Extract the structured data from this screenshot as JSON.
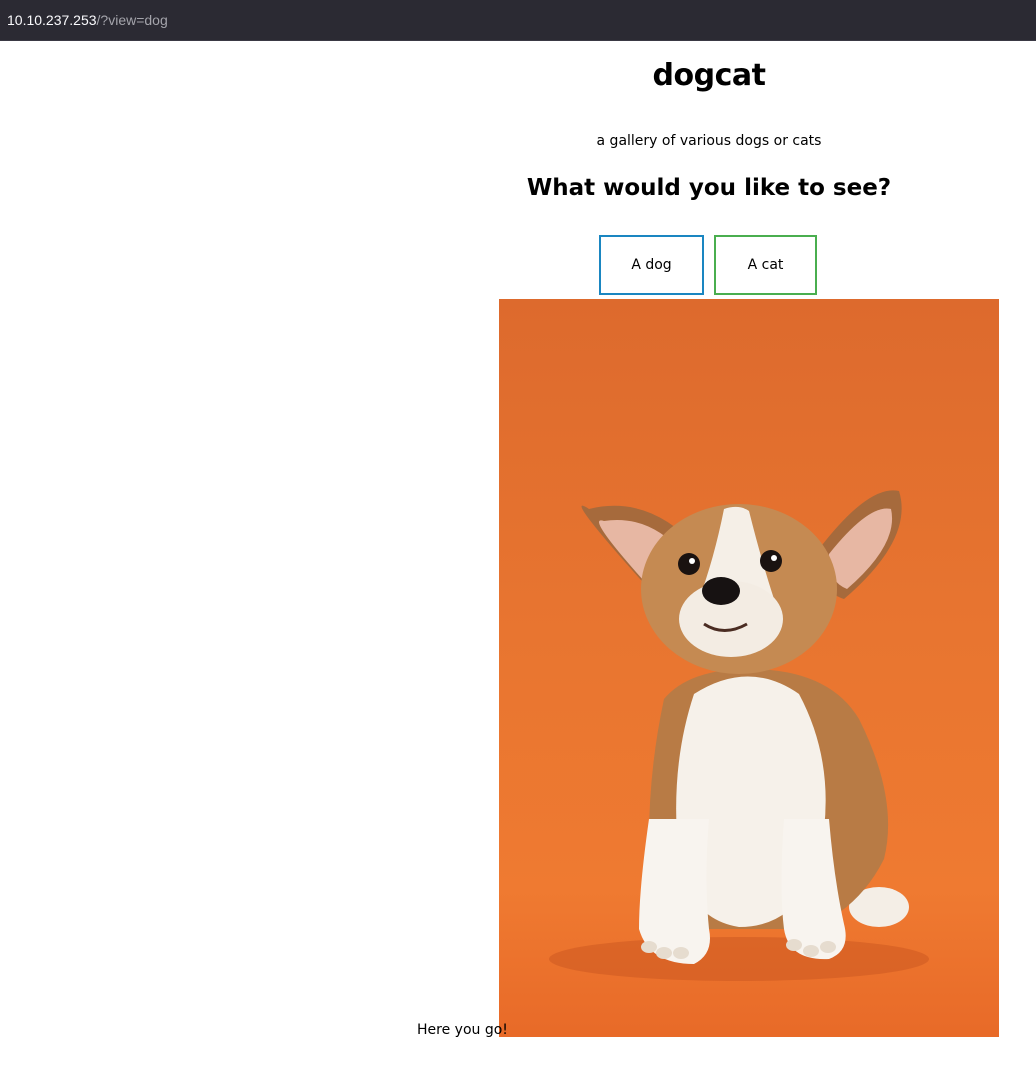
{
  "browser": {
    "url_host": "10.10.237.253",
    "url_path": "/?view=dog"
  },
  "header": {
    "title": "dogcat",
    "subtitle": "a gallery of various dogs or cats",
    "question": "What would you like to see?"
  },
  "buttons": {
    "dog_label": "A dog",
    "cat_label": "A cat"
  },
  "content": {
    "caption": "Here you go!",
    "image_subject": "corgi puppy on orange background"
  },
  "colors": {
    "dog_button_border": "#1a86c1",
    "cat_button_border": "#4aae4f",
    "image_background": "#e87530"
  }
}
